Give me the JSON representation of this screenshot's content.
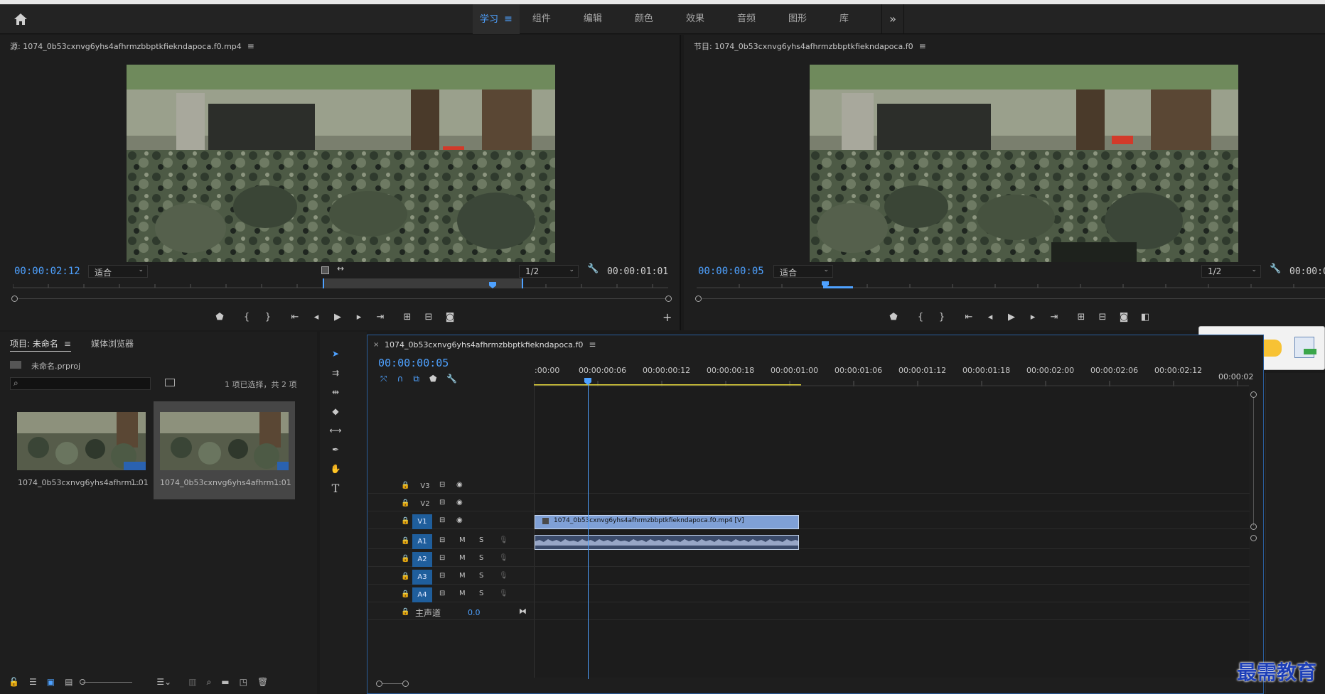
{
  "header": {
    "tabs": [
      {
        "label": "学习",
        "active": true
      },
      {
        "label": "组件",
        "active": false
      },
      {
        "label": "编辑",
        "active": false
      },
      {
        "label": "颜色",
        "active": false
      },
      {
        "label": "效果",
        "active": false
      },
      {
        "label": "音频",
        "active": false
      },
      {
        "label": "图形",
        "active": false
      },
      {
        "label": "库",
        "active": false
      }
    ],
    "tab_menu_icon": "≡",
    "more_icon": "»"
  },
  "source_monitor": {
    "title": "源: 1074_0b53cxnvg6yhs4afhrmzbbptkfiekndapoca.f0.mp4",
    "current_time": "00:00:02:12",
    "fit_label": "适合",
    "resolution": "1/2",
    "duration": "00:00:01:01"
  },
  "program_monitor": {
    "title": "节目: 1074_0b53cxnvg6yhs4afhrmzbbptkfiekndapoca.f0",
    "current_time": "00:00:00:05",
    "fit_label": "适合",
    "resolution": "1/2",
    "duration": "00:00:0"
  },
  "project": {
    "tab_label": "项目: 未命名",
    "media_browser_label": "媒体浏览器",
    "file_name": "未命名.prproj",
    "selection_status": "1 项已选择，共 2 项",
    "items": [
      {
        "name": "1074_0b53cxnvg6yhs4afhrm...",
        "duration": "1:01"
      },
      {
        "name": "1074_0b53cxnvg6yhs4afhrm...",
        "duration": "1:01"
      }
    ]
  },
  "timeline": {
    "sequence_name": "1074_0b53cxnvg6yhs4afhrmzbbptkfiekndapoca.f0",
    "current_time": "00:00:00:05",
    "ruler_labels": [
      ":00:00",
      "00:00:00:06",
      "00:00:00:12",
      "00:00:00:18",
      "00:00:01:00",
      "00:00:01:06",
      "00:00:01:12",
      "00:00:01:18",
      "00:00:02:00",
      "00:00:02:06",
      "00:00:02:12",
      "00:00:02"
    ],
    "video_tracks": [
      "V3",
      "V2",
      "V1"
    ],
    "audio_tracks": [
      "A1",
      "A2",
      "A3",
      "A4"
    ],
    "audio_mute": "M",
    "audio_solo": "S",
    "master_label": "主声道",
    "master_value": "0.0",
    "video_clip_label": "1074_0b53cxnvg6yhs4afhrmzbbptkfiekndapoca.f0.mp4 [V]"
  },
  "watermark": "最需教育",
  "colors": {
    "accent": "#4ea1ff",
    "clip_video": "#7fa0d6",
    "clip_audio": "#3a4a6a",
    "track_active": "#1f5e9c"
  }
}
